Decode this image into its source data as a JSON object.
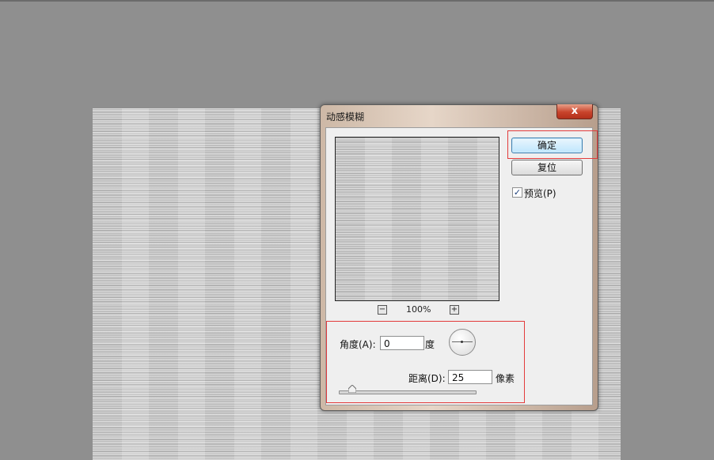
{
  "dialog": {
    "title": "动感模糊",
    "close_label": "x",
    "ok_label": "确定",
    "reset_label": "复位",
    "preview_checkbox": {
      "label": "预览(P)",
      "checked": true,
      "mark": "✓"
    },
    "zoom": {
      "minus": "−",
      "value": "100%",
      "plus": "+"
    },
    "angle": {
      "label": "角度(A):",
      "value": "0",
      "unit": "度"
    },
    "distance": {
      "label": "距离(D):",
      "value": "25",
      "unit": "像素",
      "slider_fraction": 0.1
    }
  },
  "colors": {
    "workspace": "#8f8f8f",
    "highlight": "#e33b3b",
    "close_button": "#c8432b",
    "ok_button": "#bee6fd"
  },
  "icons": [
    "close-icon",
    "zoom-out-icon",
    "zoom-in-icon",
    "checkmark-icon",
    "angle-dial-icon",
    "slider-thumb-icon"
  ]
}
